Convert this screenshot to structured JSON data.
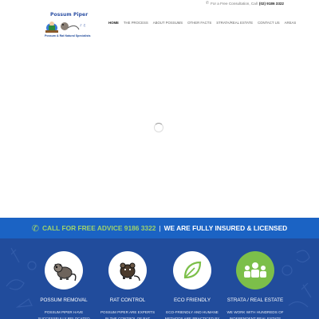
{
  "topbar": {
    "consult_text": "For a Free Consultation, Call",
    "phone": "(02) 9186 3322",
    "icon": "phone-icon"
  },
  "logo": {
    "title": "Possum Piper",
    "tagline": "Possum & Rat Natural Specialists"
  },
  "nav": {
    "items": [
      {
        "label": "HOME",
        "active": true
      },
      {
        "label": "THE PROCESS",
        "active": false
      },
      {
        "label": "ABOUT POSSUMS",
        "active": false
      },
      {
        "label": "OTHER FACTS",
        "active": false
      },
      {
        "label": "STRATA/REAL ESTATE",
        "active": false
      },
      {
        "label": "CONTACT US",
        "active": false
      },
      {
        "label": "AREAS",
        "active": false
      }
    ]
  },
  "banner": {
    "call_text": "CALL FOR FREE ADVICE 9186 3322",
    "separator": "|",
    "insured_text": "WE ARE FULLY INSURED & LICENSED",
    "icon": "phone-icon",
    "bg_color": "#1b63c4",
    "accent_color": "#9fd36a"
  },
  "services": {
    "bg_color": "#214c9c",
    "items": [
      {
        "title": "POSSUM REMOVAL",
        "desc": "POSSUM PIPER HAVE SUCCESSFULLY RELOCATED",
        "icon": "possum-icon"
      },
      {
        "title": "RAT CONTROL",
        "desc": "POSSUM PIPER ARE EXPERTS IN THE CONTROL OF RAT ACTIVITY",
        "icon": "rat-icon"
      },
      {
        "title": "ECO FRIENDLY",
        "desc": "ECO-FRIENDLY AND HUMANE METHODS ARE PRACTICED BY",
        "icon": "leaf-icon"
      },
      {
        "title": "STRATA / REAL ESTATE",
        "desc": "WE WORK WITH HUNDREDS OF INDEPENDENT REAL ESTATE",
        "icon": "people-group-icon"
      }
    ]
  }
}
